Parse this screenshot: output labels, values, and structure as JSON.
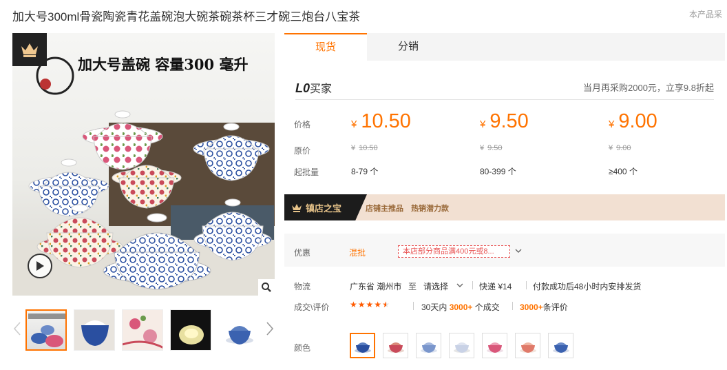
{
  "product": {
    "title": "加大号300ml骨瓷陶瓷青花盖碗泡大碗茶碗茶杯三才碗三炮台八宝茶",
    "notice": "本产品采"
  },
  "gallery": {
    "headline": "加大号盖碗  容量300 毫升",
    "thumbnail_count": 5
  },
  "tabs": [
    "现货",
    "分销"
  ],
  "buyer": {
    "level": "L0",
    "label": "买家",
    "repurchase_note": "当月再采购2000元，立享9.8折起"
  },
  "pricing": {
    "price_label": "价格",
    "original_label": "原价",
    "moq_label": "起批量",
    "currency": "¥",
    "tiers": [
      {
        "price": "10.50",
        "original": "10.50",
        "range": "8-79 个"
      },
      {
        "price": "9.50",
        "original": "9.50",
        "range": "80-399 个"
      },
      {
        "price": "9.00",
        "original": "9.00",
        "range": "≥400 个"
      }
    ]
  },
  "banner": {
    "title": "镇店之宝",
    "tags": [
      "店铺主推品",
      "热销潜力款"
    ]
  },
  "promotion": {
    "label": "优惠",
    "type": "混批",
    "tag": "本店部分商品满400元或8..."
  },
  "logistics": {
    "label": "物流",
    "origin": "广东省 潮州市",
    "to": "至",
    "destination": "请选择",
    "express": "快递 ¥14",
    "dispatch": "付款成功后48小时内安排发货"
  },
  "reviews": {
    "label": "成交\\评价",
    "rating": 4.5,
    "period": "30天内",
    "deals": "3000+",
    "deals_suffix": "个成交",
    "review_count": "3000+",
    "review_suffix": "条评价"
  },
  "colors": {
    "label": "颜色",
    "count": 7,
    "selected_index": 0
  },
  "theme": {
    "accent": "#ff7300",
    "promo_red": "#e85454"
  }
}
